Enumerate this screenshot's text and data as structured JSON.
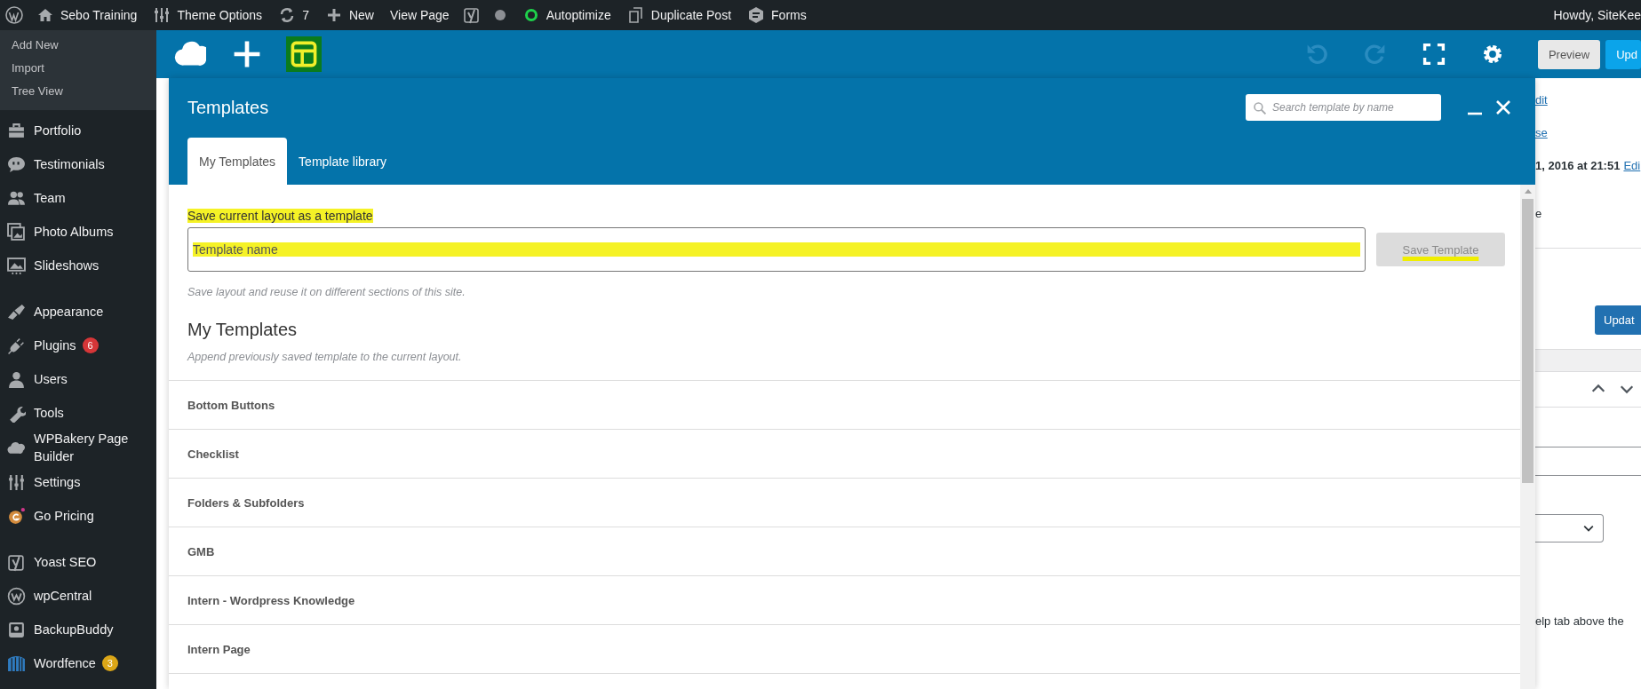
{
  "admin_bar": {
    "items": [
      {
        "kind": "wordpress"
      },
      {
        "kind": "home",
        "label": "Sebo Training"
      },
      {
        "kind": "sliders",
        "label": "Theme Options"
      },
      {
        "kind": "updates",
        "label": "7"
      },
      {
        "kind": "new",
        "label": "New"
      },
      {
        "kind": "text",
        "label": "View Page"
      },
      {
        "kind": "yoast"
      },
      {
        "kind": "dot"
      },
      {
        "kind": "ring",
        "label": "Autoptimize"
      },
      {
        "kind": "copy",
        "label": "Duplicate Post"
      },
      {
        "kind": "forms",
        "label": "Forms"
      }
    ],
    "account": "Howdy, SiteKee"
  },
  "sidebar": {
    "submenu": [
      "Add New",
      "Import",
      "Tree View"
    ],
    "groups": [
      [
        {
          "kind": "briefcase",
          "label": "Portfolio"
        },
        {
          "kind": "quote",
          "label": "Testimonials"
        },
        {
          "kind": "team",
          "label": "Team"
        },
        {
          "kind": "albums",
          "label": "Photo Albums"
        },
        {
          "kind": "slides",
          "label": "Slideshows"
        }
      ],
      [
        {
          "kind": "brush",
          "label": "Appearance"
        },
        {
          "kind": "plug",
          "label": "Plugins",
          "badge": "6",
          "color": "#d63638"
        },
        {
          "kind": "user",
          "label": "Users"
        },
        {
          "kind": "wrench",
          "label": "Tools"
        },
        {
          "kind": "cloud",
          "label": "WPBakery Page Builder"
        },
        {
          "kind": "sliders",
          "label": "Settings"
        },
        {
          "kind": "pricing",
          "label": "Go Pricing"
        }
      ],
      [
        {
          "kind": "yoast",
          "label": "Yoast SEO"
        },
        {
          "kind": "wpcentral",
          "label": "wpCentral"
        },
        {
          "kind": "backup",
          "label": "BackupBuddy"
        },
        {
          "kind": "wall",
          "label": "Wordfence",
          "badge": "3",
          "color": "#dba617"
        }
      ]
    ]
  },
  "builder": {
    "tools": [
      {
        "kind": "logo",
        "selected": false
      },
      {
        "kind": "add",
        "selected": false
      },
      {
        "kind": "templates",
        "selected": true
      }
    ],
    "actions": [
      {
        "kind": "undo",
        "disabled": true
      },
      {
        "kind": "redo",
        "disabled": true
      },
      {
        "kind": "fullscreen",
        "disabled": false
      },
      {
        "kind": "settings",
        "disabled": false
      }
    ],
    "buttons": [
      {
        "kind": "secondary",
        "label": "Preview"
      },
      {
        "kind": "primary",
        "label": "Upd"
      }
    ]
  },
  "modal": {
    "title": "Templates",
    "search": {
      "placeholder": "Search template by name"
    },
    "tabs": [
      {
        "label": "My Templates",
        "selected": true
      },
      {
        "label": "Template library",
        "selected": false
      }
    ],
    "save": {
      "label": "Save current layout as a template",
      "placeholder": "Template name",
      "button": "Save Template",
      "hint": "Save layout and reuse it on different sections of this site."
    },
    "list": {
      "heading": "My Templates",
      "subtitle": "Append previously saved template to the current layout.",
      "templates": [
        "Bottom Buttons",
        "Checklist",
        "Folders & Subfolders",
        "GMB",
        "Intern - Wordpress Knowledge",
        "Intern Page"
      ]
    }
  },
  "side_panel": {
    "lines": [
      {
        "kind": "link",
        "text": "dit"
      },
      {
        "kind": "link",
        "text": "se"
      },
      {
        "kind": "date",
        "text": "1, 2016 at 21:51",
        "link": "Edi"
      },
      {
        "kind": "text",
        "text": "e"
      }
    ],
    "update_button": "Updat",
    "help_text": "elp tab above the"
  }
}
